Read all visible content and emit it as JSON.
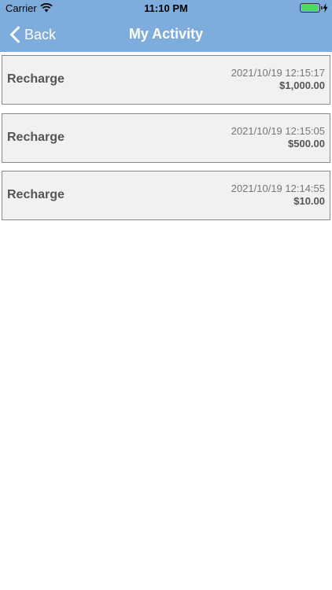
{
  "status_bar": {
    "carrier": "Carrier",
    "time": "11:10 PM",
    "battery_color": "#4cd964"
  },
  "nav": {
    "back_label": "Back",
    "title": "My Activity",
    "background_color": "#7eacdc"
  },
  "activities": [
    {
      "type": "Recharge",
      "datetime": "2021/10/19 12:15:17",
      "amount": "$1,000.00"
    },
    {
      "type": "Recharge",
      "datetime": "2021/10/19 12:15:05",
      "amount": "$500.00"
    },
    {
      "type": "Recharge",
      "datetime": "2021/10/19 12:14:55",
      "amount": "$10.00"
    }
  ],
  "icons": [
    "wifi-icon",
    "battery-icon",
    "charging-bolt-icon",
    "chevron-left-icon"
  ]
}
